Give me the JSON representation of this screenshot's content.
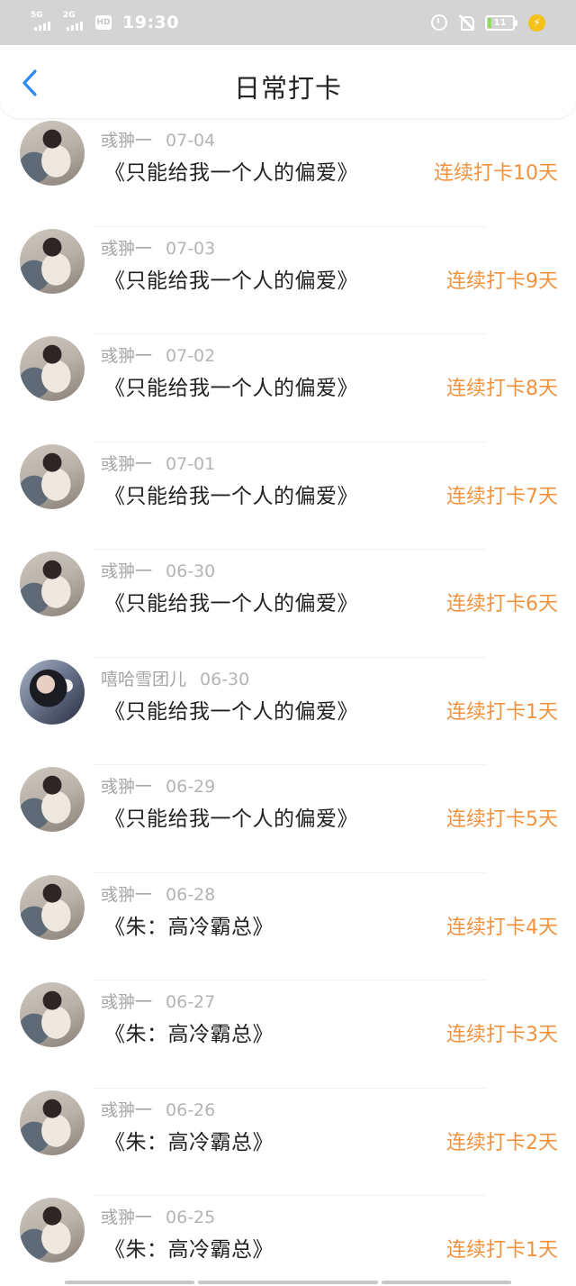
{
  "status_bar": {
    "network_1": "5G",
    "network_2": "2G",
    "hd_badge": "HD",
    "time": "19:30",
    "battery_level": "11",
    "icons": [
      "signal-icon",
      "signal-icon",
      "hd-icon",
      "alarm-icon",
      "mute-icon",
      "battery-icon",
      "charging-icon"
    ],
    "battery_fill_color": "#8be05a",
    "charge_color": "#f3c21b"
  },
  "header": {
    "title": "日常打卡",
    "back_icon": "chevron-left-icon",
    "accent_color": "#2f8cf0"
  },
  "streak_color": "#f0923e",
  "checkins": [
    {
      "user": "彧翀一",
      "date": "07-04",
      "title": "《只能给我一个人的偏爱》",
      "streak": "连续打卡10天",
      "avatar": "a1"
    },
    {
      "user": "彧翀一",
      "date": "07-03",
      "title": "《只能给我一个人的偏爱》",
      "streak": "连续打卡9天",
      "avatar": "a1"
    },
    {
      "user": "彧翀一",
      "date": "07-02",
      "title": "《只能给我一个人的偏爱》",
      "streak": "连续打卡8天",
      "avatar": "a1"
    },
    {
      "user": "彧翀一",
      "date": "07-01",
      "title": "《只能给我一个人的偏爱》",
      "streak": "连续打卡7天",
      "avatar": "a1"
    },
    {
      "user": "彧翀一",
      "date": "06-30",
      "title": "《只能给我一个人的偏爱》",
      "streak": "连续打卡6天",
      "avatar": "a1"
    },
    {
      "user": "嘻哈雪团儿",
      "date": "06-30",
      "title": "《只能给我一个人的偏爱》",
      "streak": "连续打卡1天",
      "avatar": "a2"
    },
    {
      "user": "彧翀一",
      "date": "06-29",
      "title": "《只能给我一个人的偏爱》",
      "streak": "连续打卡5天",
      "avatar": "a1"
    },
    {
      "user": "彧翀一",
      "date": "06-28",
      "title": "《朱：高冷霸总》",
      "streak": "连续打卡4天",
      "avatar": "a1"
    },
    {
      "user": "彧翀一",
      "date": "06-27",
      "title": "《朱：高冷霸总》",
      "streak": "连续打卡3天",
      "avatar": "a1"
    },
    {
      "user": "彧翀一",
      "date": "06-26",
      "title": "《朱：高冷霸总》",
      "streak": "连续打卡2天",
      "avatar": "a1"
    },
    {
      "user": "彧翀一",
      "date": "06-25",
      "title": "《朱：高冷霸总》",
      "streak": "连续打卡1天",
      "avatar": "a1"
    }
  ]
}
